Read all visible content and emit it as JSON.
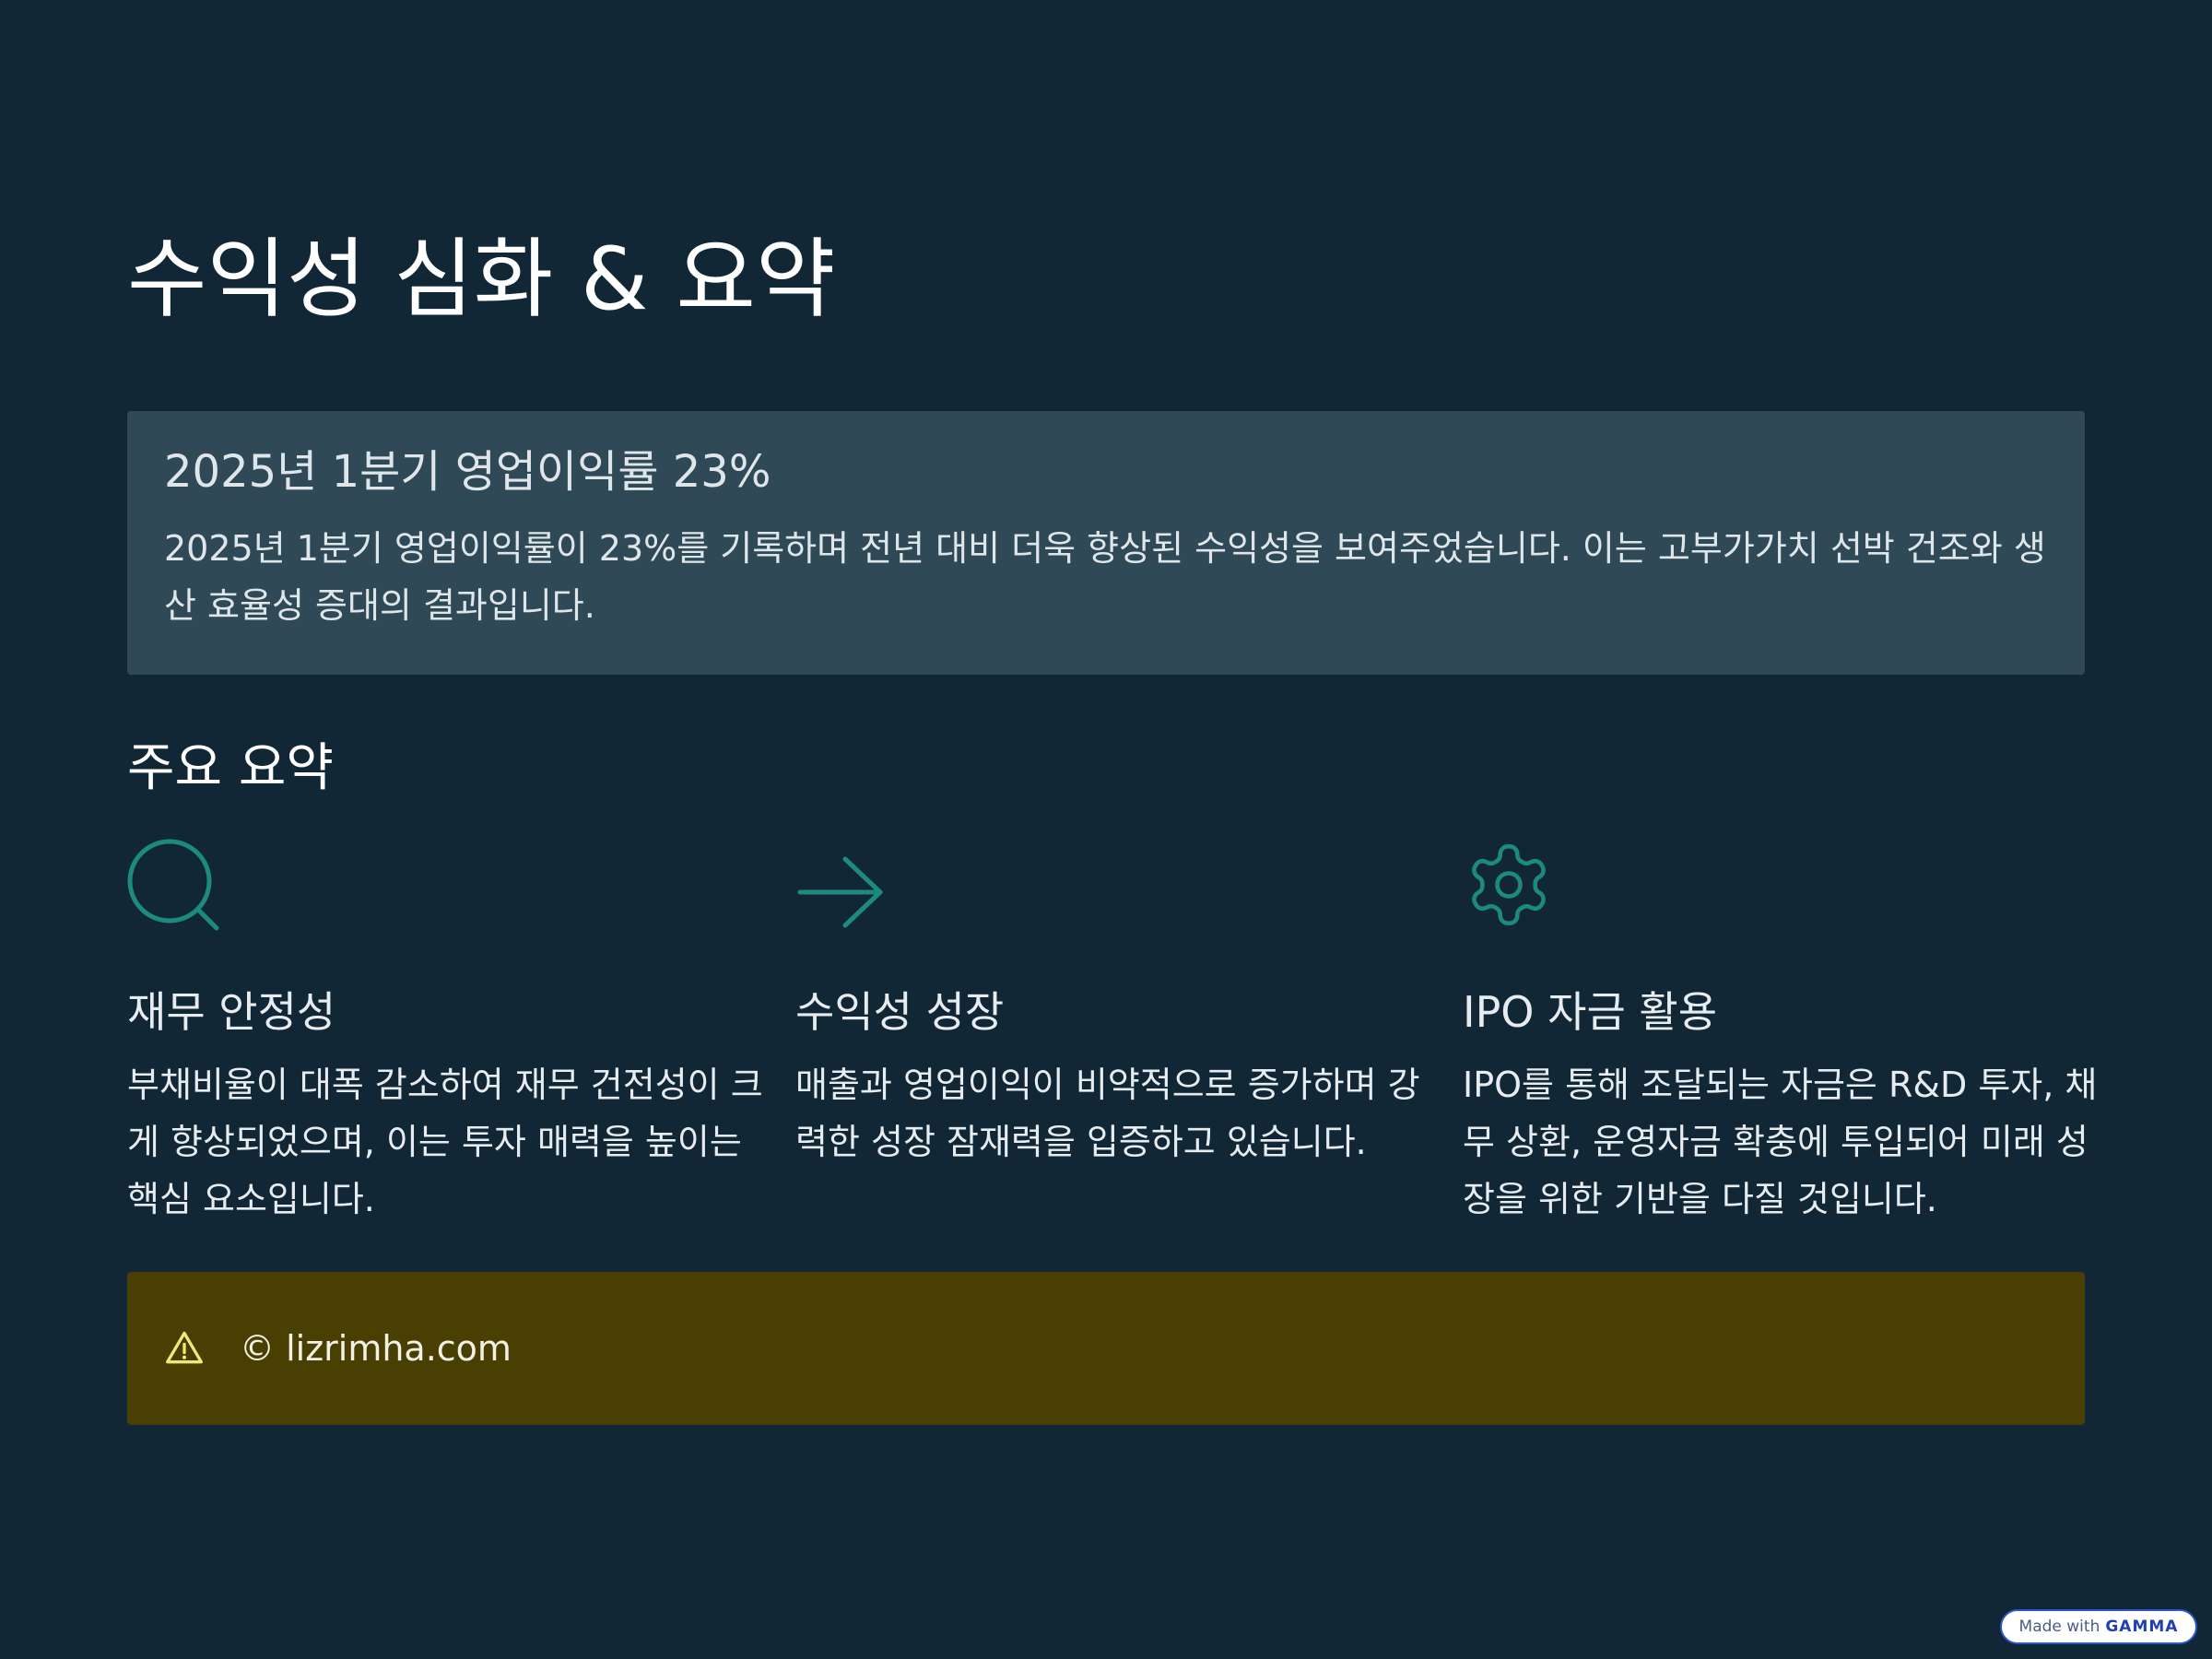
{
  "page": {
    "title": "수익성 심화 & 요약"
  },
  "highlight": {
    "heading": "2025년 1분기 영업이익률 23%",
    "body": "2025년 1분기 영업이익률이 23%를 기록하며 전년 대비 더욱 향상된 수익성을 보여주었습니다. 이는 고부가가치 선박 건조와 생산 효율성 증대의 결과입니다."
  },
  "summary": {
    "title": "주요 요약",
    "cards": [
      {
        "icon": "search-icon",
        "heading": "재무 안정성",
        "body": "부채비율이 대폭 감소하여 재무 건전성이 크게 향상되었으며, 이는 투자 매력을 높이는 핵심 요소입니다."
      },
      {
        "icon": "arrow-right-icon",
        "heading": "수익성 성장",
        "body": "매출과 영업이익이 비약적으로 증가하며 강력한 성장 잠재력을 입증하고 있습니다."
      },
      {
        "icon": "gear-icon",
        "heading": "IPO 자금 활용",
        "body": "IPO를 통해 조달되는 자금은 R&D 투자, 채무 상환, 운영자금 확충에 투입되어 미래 성장을 위한 기반을 다질 것입니다."
      }
    ]
  },
  "notice": {
    "icon": "warning-icon",
    "text": "© lizrimha.com"
  },
  "badge": {
    "prefix": "Made with",
    "brand": "GAMMA"
  },
  "colors": {
    "background": "#122736",
    "highlight_box": "#304957",
    "notice_box": "#4a3f02",
    "icon_accent": "#1d8a7e",
    "warning_icon": "#f1e77a"
  }
}
